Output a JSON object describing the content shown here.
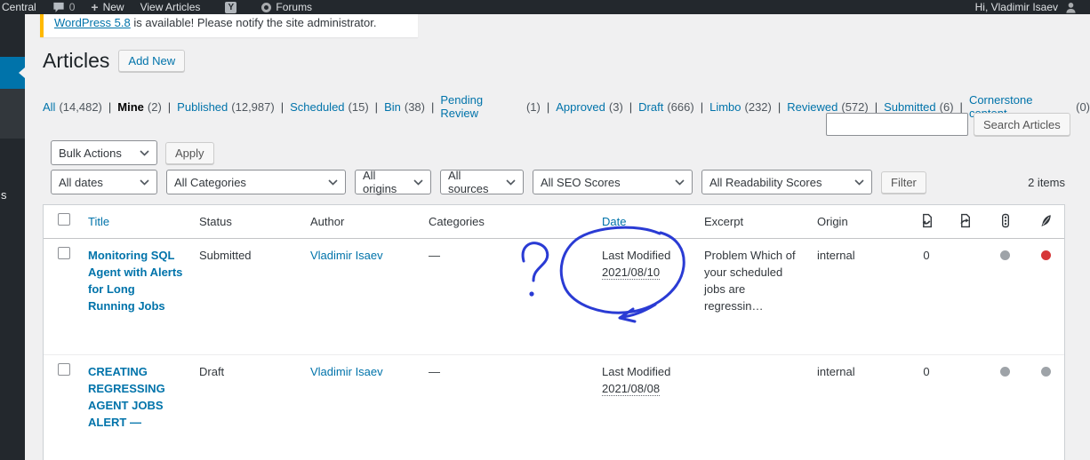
{
  "admin_bar": {
    "site_label": "Central",
    "comments_count": "0",
    "new_label": "New",
    "view_articles_label": "View Articles",
    "forums_label": "Forums",
    "greeting": "Hi, Vladimir Isaev"
  },
  "sidebar": {
    "submenu_fragment": "s"
  },
  "notice": {
    "link_text": "WordPress 5.8",
    "rest_text": " is available! Please notify the site administrator."
  },
  "page": {
    "title": "Articles",
    "add_new_label": "Add New"
  },
  "status_filters": [
    {
      "label": "All",
      "count": "(14,482)"
    },
    {
      "label": "Mine",
      "count": "(2)"
    },
    {
      "label": "Published",
      "count": "(12,987)"
    },
    {
      "label": "Scheduled",
      "count": "(15)"
    },
    {
      "label": "Bin",
      "count": "(38)"
    },
    {
      "label": "Pending Review",
      "count": "(1)"
    },
    {
      "label": "Approved",
      "count": "(3)"
    },
    {
      "label": "Draft",
      "count": "(666)"
    },
    {
      "label": "Limbo",
      "count": "(232)"
    },
    {
      "label": "Reviewed",
      "count": "(572)"
    },
    {
      "label": "Submitted",
      "count": "(6)"
    },
    {
      "label": "Cornerstone content",
      "count": "(0)"
    }
  ],
  "search": {
    "value": "",
    "button_label": "Search Articles"
  },
  "bulk": {
    "action_label": "Bulk Actions",
    "apply_label": "Apply"
  },
  "filters": {
    "dates": "All dates",
    "categories": "All Categories",
    "origins": "All origins",
    "sources": "All sources",
    "seo": "All SEO Scores",
    "readability": "All Readability Scores",
    "filter_label": "Filter",
    "items_count": "2 items"
  },
  "table": {
    "headers": {
      "title": "Title",
      "status": "Status",
      "author": "Author",
      "categories": "Categories",
      "date": "Date",
      "excerpt": "Excerpt",
      "origin": "Origin"
    },
    "header_icons": {
      "incoming_links": "document-with-incoming-arrow",
      "outgoing_links": "document-with-outgoing-arrow",
      "seo_score": "traffic-light",
      "readability_score": "feather"
    },
    "rows": [
      {
        "title": "Monitoring SQL Agent with Alerts for Long Running Jobs",
        "status": "Submitted",
        "author": "Vladimir Isaev",
        "categories": "—",
        "date_label": "Last Modified",
        "date_value": "2021/08/10",
        "excerpt": "Problem Which of your scheduled jobs are regressin…",
        "origin": "internal",
        "incoming_links": "0",
        "seo_color": "#9ea3a8",
        "readability_color": "#d63638"
      },
      {
        "title": "CREATING REGRESSING AGENT JOBS ALERT —",
        "status": "Draft",
        "author": "Vladimir Isaev",
        "categories": "—",
        "date_label": "Last Modified",
        "date_value": "2021/08/08",
        "excerpt": "",
        "origin": "internal",
        "incoming_links": "0",
        "seo_color": "#9ea3a8",
        "readability_color": "#9ea3a8"
      }
    ]
  },
  "annotation": {
    "color": "#2a3bd4",
    "question_mark": "?",
    "circled_text": "Last Modified 2021/08/10"
  },
  "colors": {
    "accent_blue": "#0073aa",
    "admin_dark": "#23282d",
    "notice_yellow": "#ffb900",
    "dot_gray": "#9ea3a8",
    "dot_red": "#d63638"
  },
  "icons": {
    "comments": "speech-bubble",
    "new": "plus",
    "yoast": "Y-badge",
    "forums": "ring",
    "avatar": "person-silhouette",
    "select": "chevron-down"
  }
}
